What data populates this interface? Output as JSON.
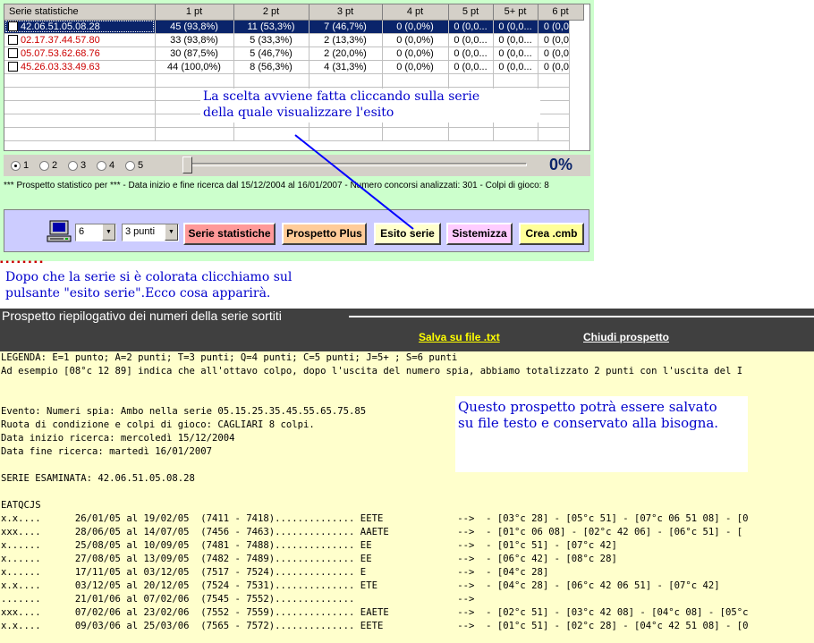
{
  "grid": {
    "headers": [
      "Serie statistiche",
      "1 pt",
      "2 pt",
      "3 pt",
      "4 pt",
      "5 pt",
      "5+ pt",
      "6 pt"
    ],
    "rows": [
      {
        "serie": "42.06.51.05.08.28",
        "pt1": "45 (93,8%)",
        "pt2": "11 (53,3%)",
        "pt3": "7 (46,7%)",
        "pt4": "0 (0,0%)",
        "pt5": "0 (0,0...",
        "pt5p": "0 (0,0...",
        "pt6": "0 (0,0..."
      },
      {
        "serie": "02.17.37.44.57.80",
        "pt1": "33 (93,8%)",
        "pt2": "5 (33,3%)",
        "pt3": "2 (13,3%)",
        "pt4": "0 (0,0%)",
        "pt5": "0 (0,0...",
        "pt5p": "0 (0,0...",
        "pt6": "0 (0,0..."
      },
      {
        "serie": "05.07.53.62.68.76",
        "pt1": "30 (87,5%)",
        "pt2": "5 (46,7%)",
        "pt3": "2 (20,0%)",
        "pt4": "0 (0,0%)",
        "pt5": "0 (0,0...",
        "pt5p": "0 (0,0...",
        "pt6": "0 (0,0..."
      },
      {
        "serie": "45.26.03.33.49.63",
        "pt1": "44 (100,0%)",
        "pt2": "8 (56,3%)",
        "pt3": "4 (31,3%)",
        "pt4": "0 (0,0%)",
        "pt5": "0 (0,0...",
        "pt5p": "0 (0,0...",
        "pt6": "0 (0,0..."
      }
    ]
  },
  "radios": [
    "1",
    "2",
    "3",
    "4",
    "5"
  ],
  "selected_radio": "1",
  "progress_percent": "0%",
  "info_line": "*** Prospetto statistico per  ***  - Data inizio e fine ricerca dal 15/12/2004 al 16/01/2007 - Numero concorsi analizzati: 301 - Colpi di gioco: 8",
  "controls": {
    "combo1_value": "6",
    "combo2_value": "3 punti",
    "buttons": [
      {
        "label": "Serie statistiche",
        "color": "#ff9999"
      },
      {
        "label": "Prospetto Plus",
        "color": "#ffcc99"
      },
      {
        "label": "Esito serie",
        "color": "#ffffcc"
      },
      {
        "label": "Sistemizza",
        "color": "#ffccff"
      },
      {
        "label": "Crea .cmb",
        "color": "#ffff99"
      }
    ]
  },
  "annotations": {
    "a1_line1": "La scelta avviene fatta cliccando sulla serie",
    "a1_line2": "della quale visualizzare l'esito",
    "a2_line1": "Dopo che la serie si è colorata clicchiamo sul",
    "a2_line2": "pulsante \"esito serie\".Ecco cosa apparirà.",
    "a3_line1": "Questo prospetto potrà essere salvato",
    "a3_line2": "su file testo e conservato alla bisogna."
  },
  "panel": {
    "title": "Prospetto riepilogativo dei numeri della serie sortiti",
    "save_link": "Salva su file .txt",
    "close_link": "Chiudi prospetto"
  },
  "report_lines": [
    "LEGENDA: E=1 punto; A=2 punti; T=3 punti; Q=4 punti; C=5 punti; J=5+ ; S=6 punti",
    "Ad esempio [08°c 12 89] indica che all'ottavo colpo, dopo l'uscita del numero spia, abbiamo totalizzato 2 punti con l'uscita del I",
    "",
    "",
    "Evento: Numeri spia: Ambo nella serie 05.15.25.35.45.55.65.75.85",
    "Ruota di condizione e colpi di gioco: CAGLIARI 8 colpi.",
    "Data inizio ricerca: mercoledì 15/12/2004",
    "Data fine ricerca: martedì 16/01/2007",
    "",
    "SERIE ESAMINATA: 42.06.51.05.08.28",
    "",
    "EATQCJS",
    "x.x....      26/01/05 al 19/02/05  (7411 - 7418).............. EETE             -->  - [03°c 28] - [05°c 51] - [07°c 06 51 08] - [0",
    "xxx....      28/06/05 al 14/07/05  (7456 - 7463).............. AAETE            -->  - [01°c 06 08] - [02°c 42 06] - [06°c 51] - [",
    "x......      25/08/05 al 10/09/05  (7481 - 7488).............. EE               -->  - [01°c 51] - [07°c 42]",
    "x......      27/08/05 al 13/09/05  (7482 - 7489).............. EE               -->  - [06°c 42] - [08°c 28]",
    "x......      17/11/05 al 03/12/05  (7517 - 7524).............. E                -->  - [04°c 28]",
    "x.x....      03/12/05 al 20/12/05  (7524 - 7531).............. ETE              -->  - [04°c 28] - [06°c 42 06 51] - [07°c 42]",
    ".......      21/01/06 al 07/02/06  (7545 - 7552)..............                  -->",
    "xxx....      07/02/06 al 23/02/06  (7552 - 7559).............. EAETE            -->  - [02°c 51] - [03°c 42 08] - [04°c 08] - [05°c",
    "x.x....      09/03/06 al 25/03/06  (7565 - 7572).............. EETE             -->  - [01°c 51] - [02°c 28] - [04°c 42 51 08] - [0"
  ]
}
